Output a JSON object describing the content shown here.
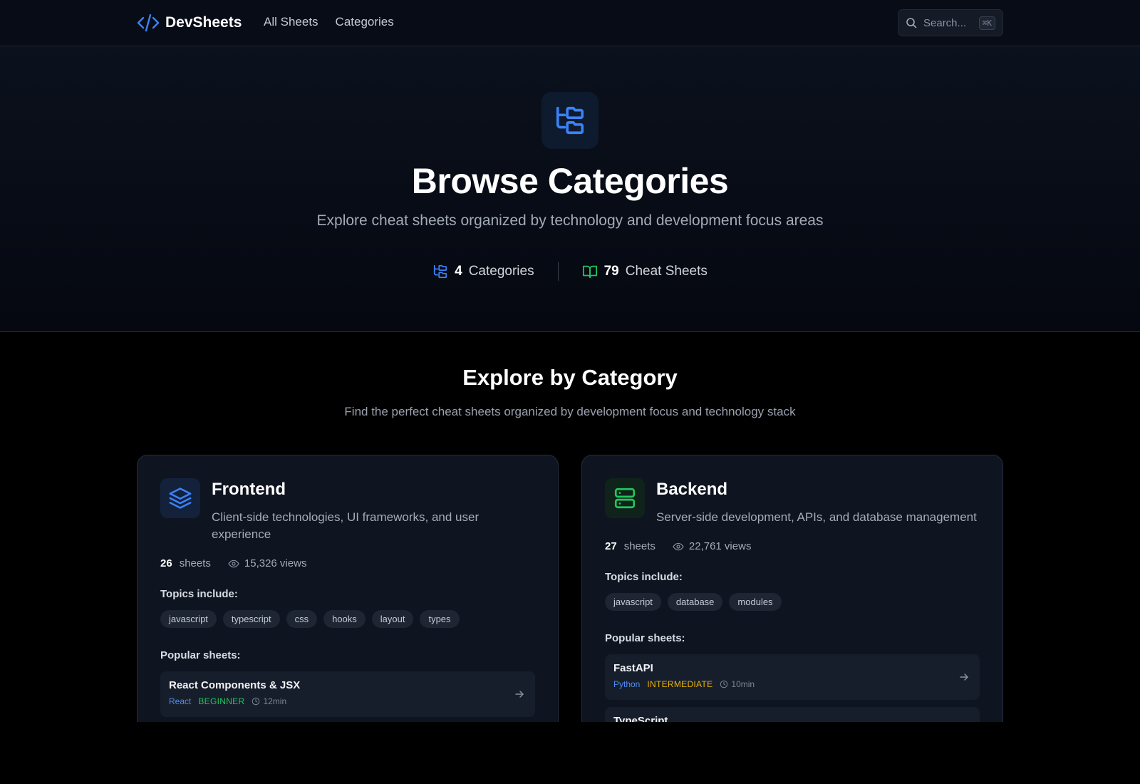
{
  "header": {
    "brand": "DevSheets",
    "nav": [
      "All Sheets",
      "Categories"
    ],
    "search_placeholder": "Search...",
    "search_shortcut": "⌘K"
  },
  "hero": {
    "title": "Browse Categories",
    "subtitle": "Explore cheat sheets organized by technology and development focus areas",
    "stats": {
      "categories_count": "4",
      "categories_label": "Categories",
      "sheets_count": "79",
      "sheets_label": "Cheat Sheets"
    }
  },
  "explore": {
    "title": "Explore by Category",
    "subtitle": "Find the perfect cheat sheets organized by development focus and technology stack"
  },
  "labels": {
    "topics": "Topics include:",
    "popular": "Popular sheets:",
    "sheets_word": "sheets"
  },
  "categories": [
    {
      "name": "Frontend",
      "description": "Client-side technologies, UI frameworks, and user experience",
      "sheet_count": "26",
      "views": "15,326 views",
      "icon": "layers-icon",
      "accent": "#3b82f6",
      "tags": [
        "javascript",
        "typescript",
        "css",
        "hooks",
        "layout",
        "types"
      ],
      "sheets": [
        {
          "title": "React Components & JSX",
          "lang": "React",
          "level": "BEGINNER",
          "time": "12min"
        },
        {
          "title": "",
          "lang": "",
          "level": "",
          "time": ""
        }
      ]
    },
    {
      "name": "Backend",
      "description": "Server-side development, APIs, and database management",
      "sheet_count": "27",
      "views": "22,761 views",
      "icon": "server-icon",
      "accent": "#22c55e",
      "tags": [
        "javascript",
        "database",
        "modules"
      ],
      "sheets": [
        {
          "title": "FastAPI",
          "lang": "Python",
          "level": "INTERMEDIATE",
          "time": "10min"
        },
        {
          "title": "TypeScript",
          "lang": "",
          "level": "",
          "time": ""
        }
      ]
    }
  ],
  "colors": {
    "page_bg": "#000000",
    "card_bg": "#0e1420",
    "accent_blue": "#3b82f6",
    "accent_green": "#22c55e",
    "beginner": "#22c55e",
    "intermediate": "#eab308"
  }
}
